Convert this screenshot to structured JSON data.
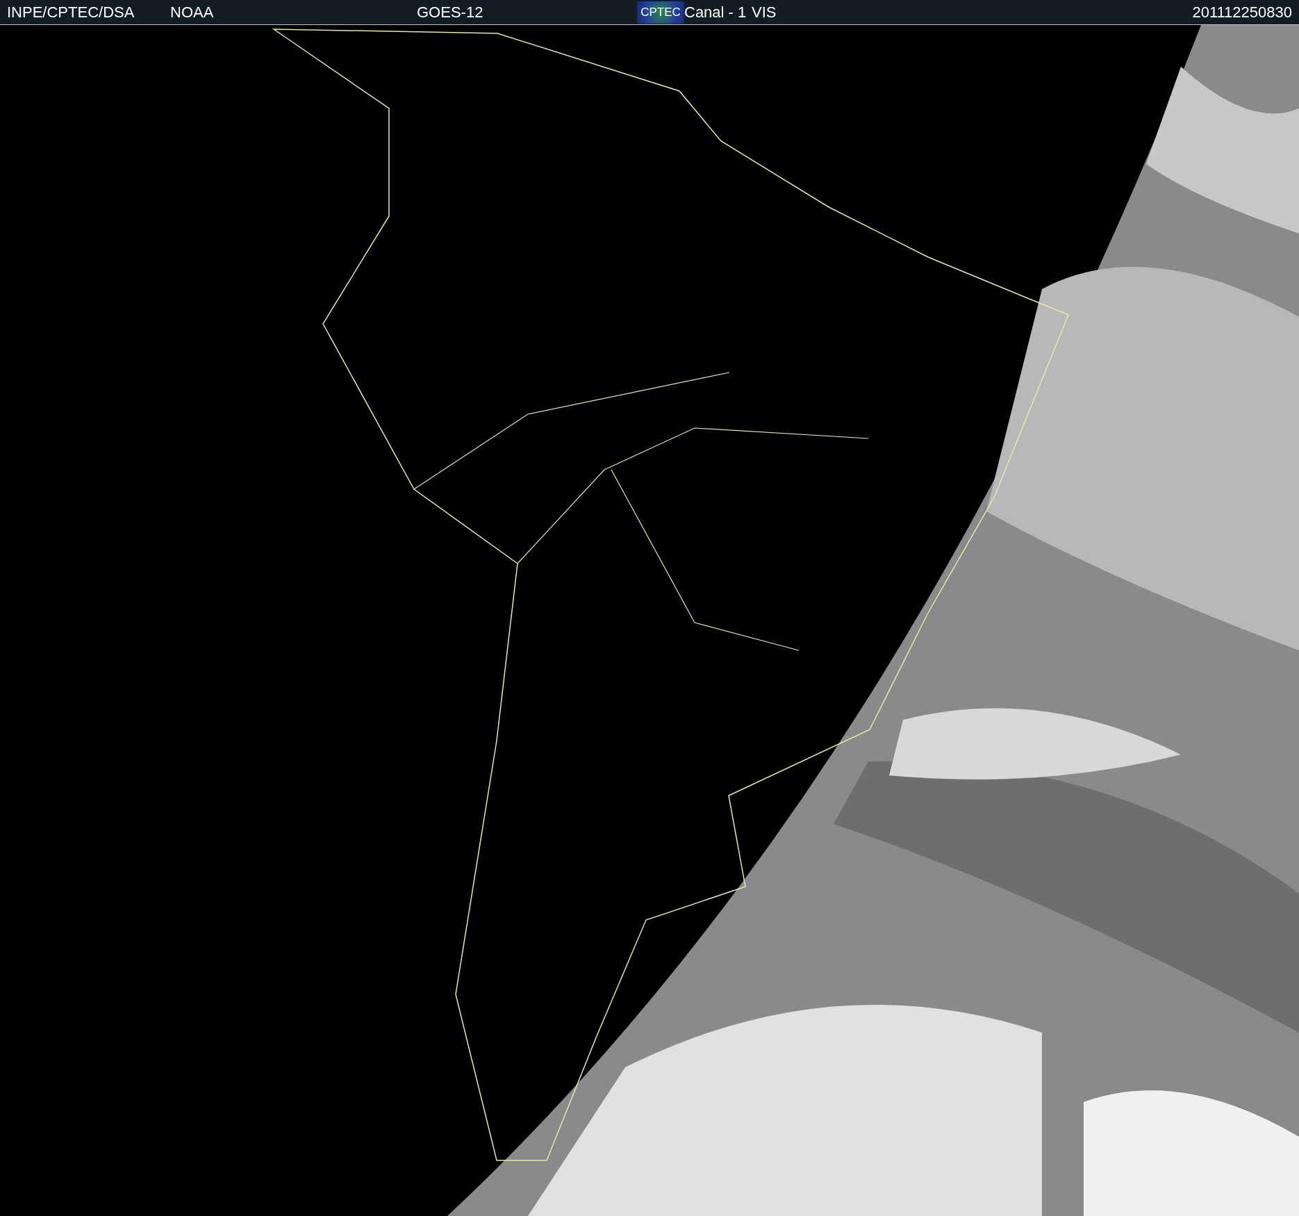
{
  "header": {
    "source": "INPE/CPTEC/DSA",
    "agency": "NOAA",
    "satellite": "GOES-12",
    "logo": "CPTEC",
    "channel": "Canal - 1",
    "band": "VIS",
    "timestamp": "201112250830"
  }
}
